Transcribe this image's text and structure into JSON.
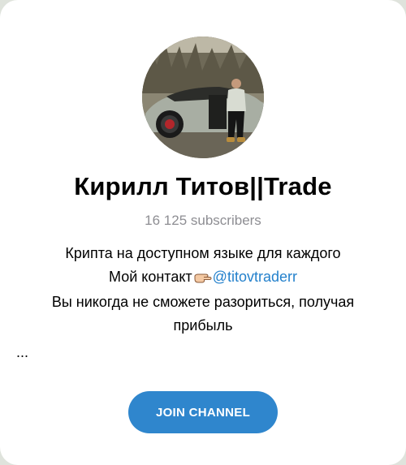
{
  "channel": {
    "title": "Кирилл Титов||Trade",
    "subscribers": "16 125 subscribers",
    "description": {
      "line1": "Крипта на доступном языке для каждого",
      "contact_prefix": "Мой контакт",
      "contact_emoji": "pointing-hand-icon",
      "contact_link": "@titovtraderr",
      "line3": "Вы никогда не сможете разориться, получая",
      "line4": "прибыль",
      "more": "..."
    }
  },
  "actions": {
    "join_label": "JOIN CHANNEL"
  },
  "colors": {
    "accent": "#2f86cd",
    "link": "#2481cc",
    "muted": "#8e8e93"
  }
}
